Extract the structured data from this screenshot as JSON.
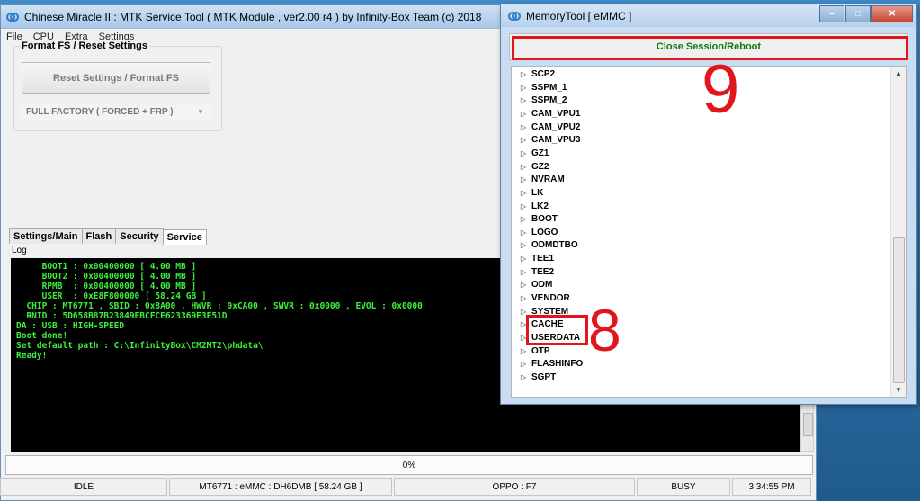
{
  "main_window": {
    "title": "Chinese Miracle II : MTK Service Tool ( MTK Module , ver2.00 r4  ) by Infinity-Box Team (c) 2018",
    "menu": [
      "File",
      "CPU",
      "Extra",
      "Settings"
    ],
    "format_group_label": "Format FS / Reset Settings",
    "reset_button_label": "Reset Settings / Format FS",
    "mode_select_value": "FULL FACTORY ( FORCED + FRP )",
    "tabs": [
      "Settings/Main",
      "Flash",
      "Security",
      "Service"
    ],
    "active_tab": "Service",
    "log_label": "Log",
    "log_lines": [
      "     BOOT1 : 0x00400000 [ 4.00 MB ]",
      "     BOOT2 : 0x00400000 [ 4.00 MB ]",
      "     RPMB  : 0x00400000 [ 4.00 MB ]",
      "     USER  : 0xE8F800000 [ 58.24 GB ]",
      "",
      "  CHIP : MT6771 , SBID : 0x8A00 , HWVR : 0xCA00 , SWVR : 0x0000 , EVOL : 0x0000",
      "",
      "  RNID : 5D658B87B23849EBCFCE623369E3E51D",
      "",
      "DA : USB : HIGH-SPEED",
      "",
      "Boot done!",
      "",
      "Set default path : C:\\InfinityBox\\CM2MT2\\phdata\\",
      "",
      "Ready!"
    ],
    "progress_text": "0%",
    "progress_value": 0,
    "status": {
      "state": "IDLE",
      "device": "MT6771 : eMMC : DH6DMB  [ 58.24 GB ]",
      "model": "OPPO : F7",
      "busy": "BUSY",
      "time": "3:34:55 PM"
    }
  },
  "memory_tool": {
    "title": "MemoryTool [ eMMC ]",
    "close_session_label": "Close Session/Reboot",
    "partitions": [
      "SCP2",
      "SSPM_1",
      "SSPM_2",
      "CAM_VPU1",
      "CAM_VPU2",
      "CAM_VPU3",
      "GZ1",
      "GZ2",
      "NVRAM",
      "LK",
      "LK2",
      "BOOT",
      "LOGO",
      "ODMDTBO",
      "TEE1",
      "TEE2",
      "ODM",
      "VENDOR",
      "SYSTEM",
      "CACHE",
      "USERDATA",
      "OTP",
      "FLASHINFO",
      "SGPT"
    ],
    "annotation_9": "9",
    "annotation_8": "8"
  },
  "colors": {
    "log_text": "#3cf03c",
    "annotation_red": "#e1151c",
    "close_session_text": "#0b7a0b"
  }
}
